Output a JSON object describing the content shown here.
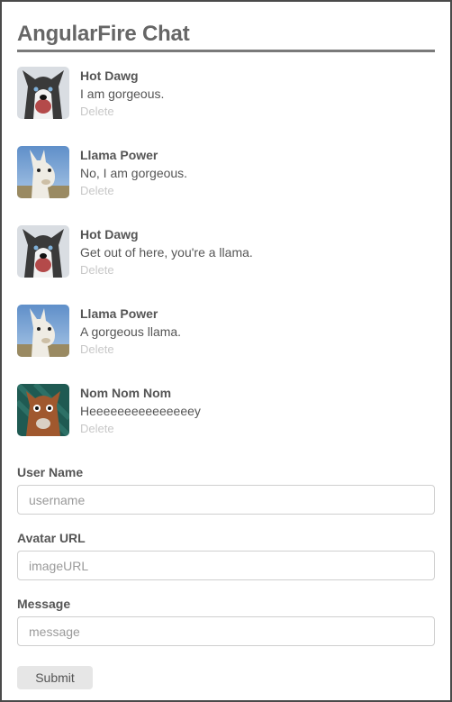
{
  "app": {
    "title": "AngularFire Chat"
  },
  "messages": [
    {
      "name": "Hot Dawg",
      "text": "I am gorgeous.",
      "delete_label": "Delete",
      "avatar": "husky-avatar"
    },
    {
      "name": "Llama Power",
      "text": "No, I am gorgeous.",
      "delete_label": "Delete",
      "avatar": "llama-avatar"
    },
    {
      "name": "Hot Dawg",
      "text": "Get out of here, you're a llama.",
      "delete_label": "Delete",
      "avatar": "husky-avatar"
    },
    {
      "name": "Llama Power",
      "text": "A gorgeous llama.",
      "delete_label": "Delete",
      "avatar": "llama-avatar"
    },
    {
      "name": "Nom Nom Nom",
      "text": "Heeeeeeeeeeeeeeey",
      "delete_label": "Delete",
      "avatar": "alpaca-avatar"
    }
  ],
  "form": {
    "username": {
      "label": "User Name",
      "placeholder": "username",
      "value": ""
    },
    "avatar_url": {
      "label": "Avatar URL",
      "placeholder": "imageURL",
      "value": ""
    },
    "message": {
      "label": "Message",
      "placeholder": "message",
      "value": ""
    },
    "submit_label": "Submit"
  },
  "colors": {
    "border": "#4a4a4a",
    "text": "#555555",
    "muted": "#c8c8c8",
    "button_bg": "#e6e6e6"
  }
}
